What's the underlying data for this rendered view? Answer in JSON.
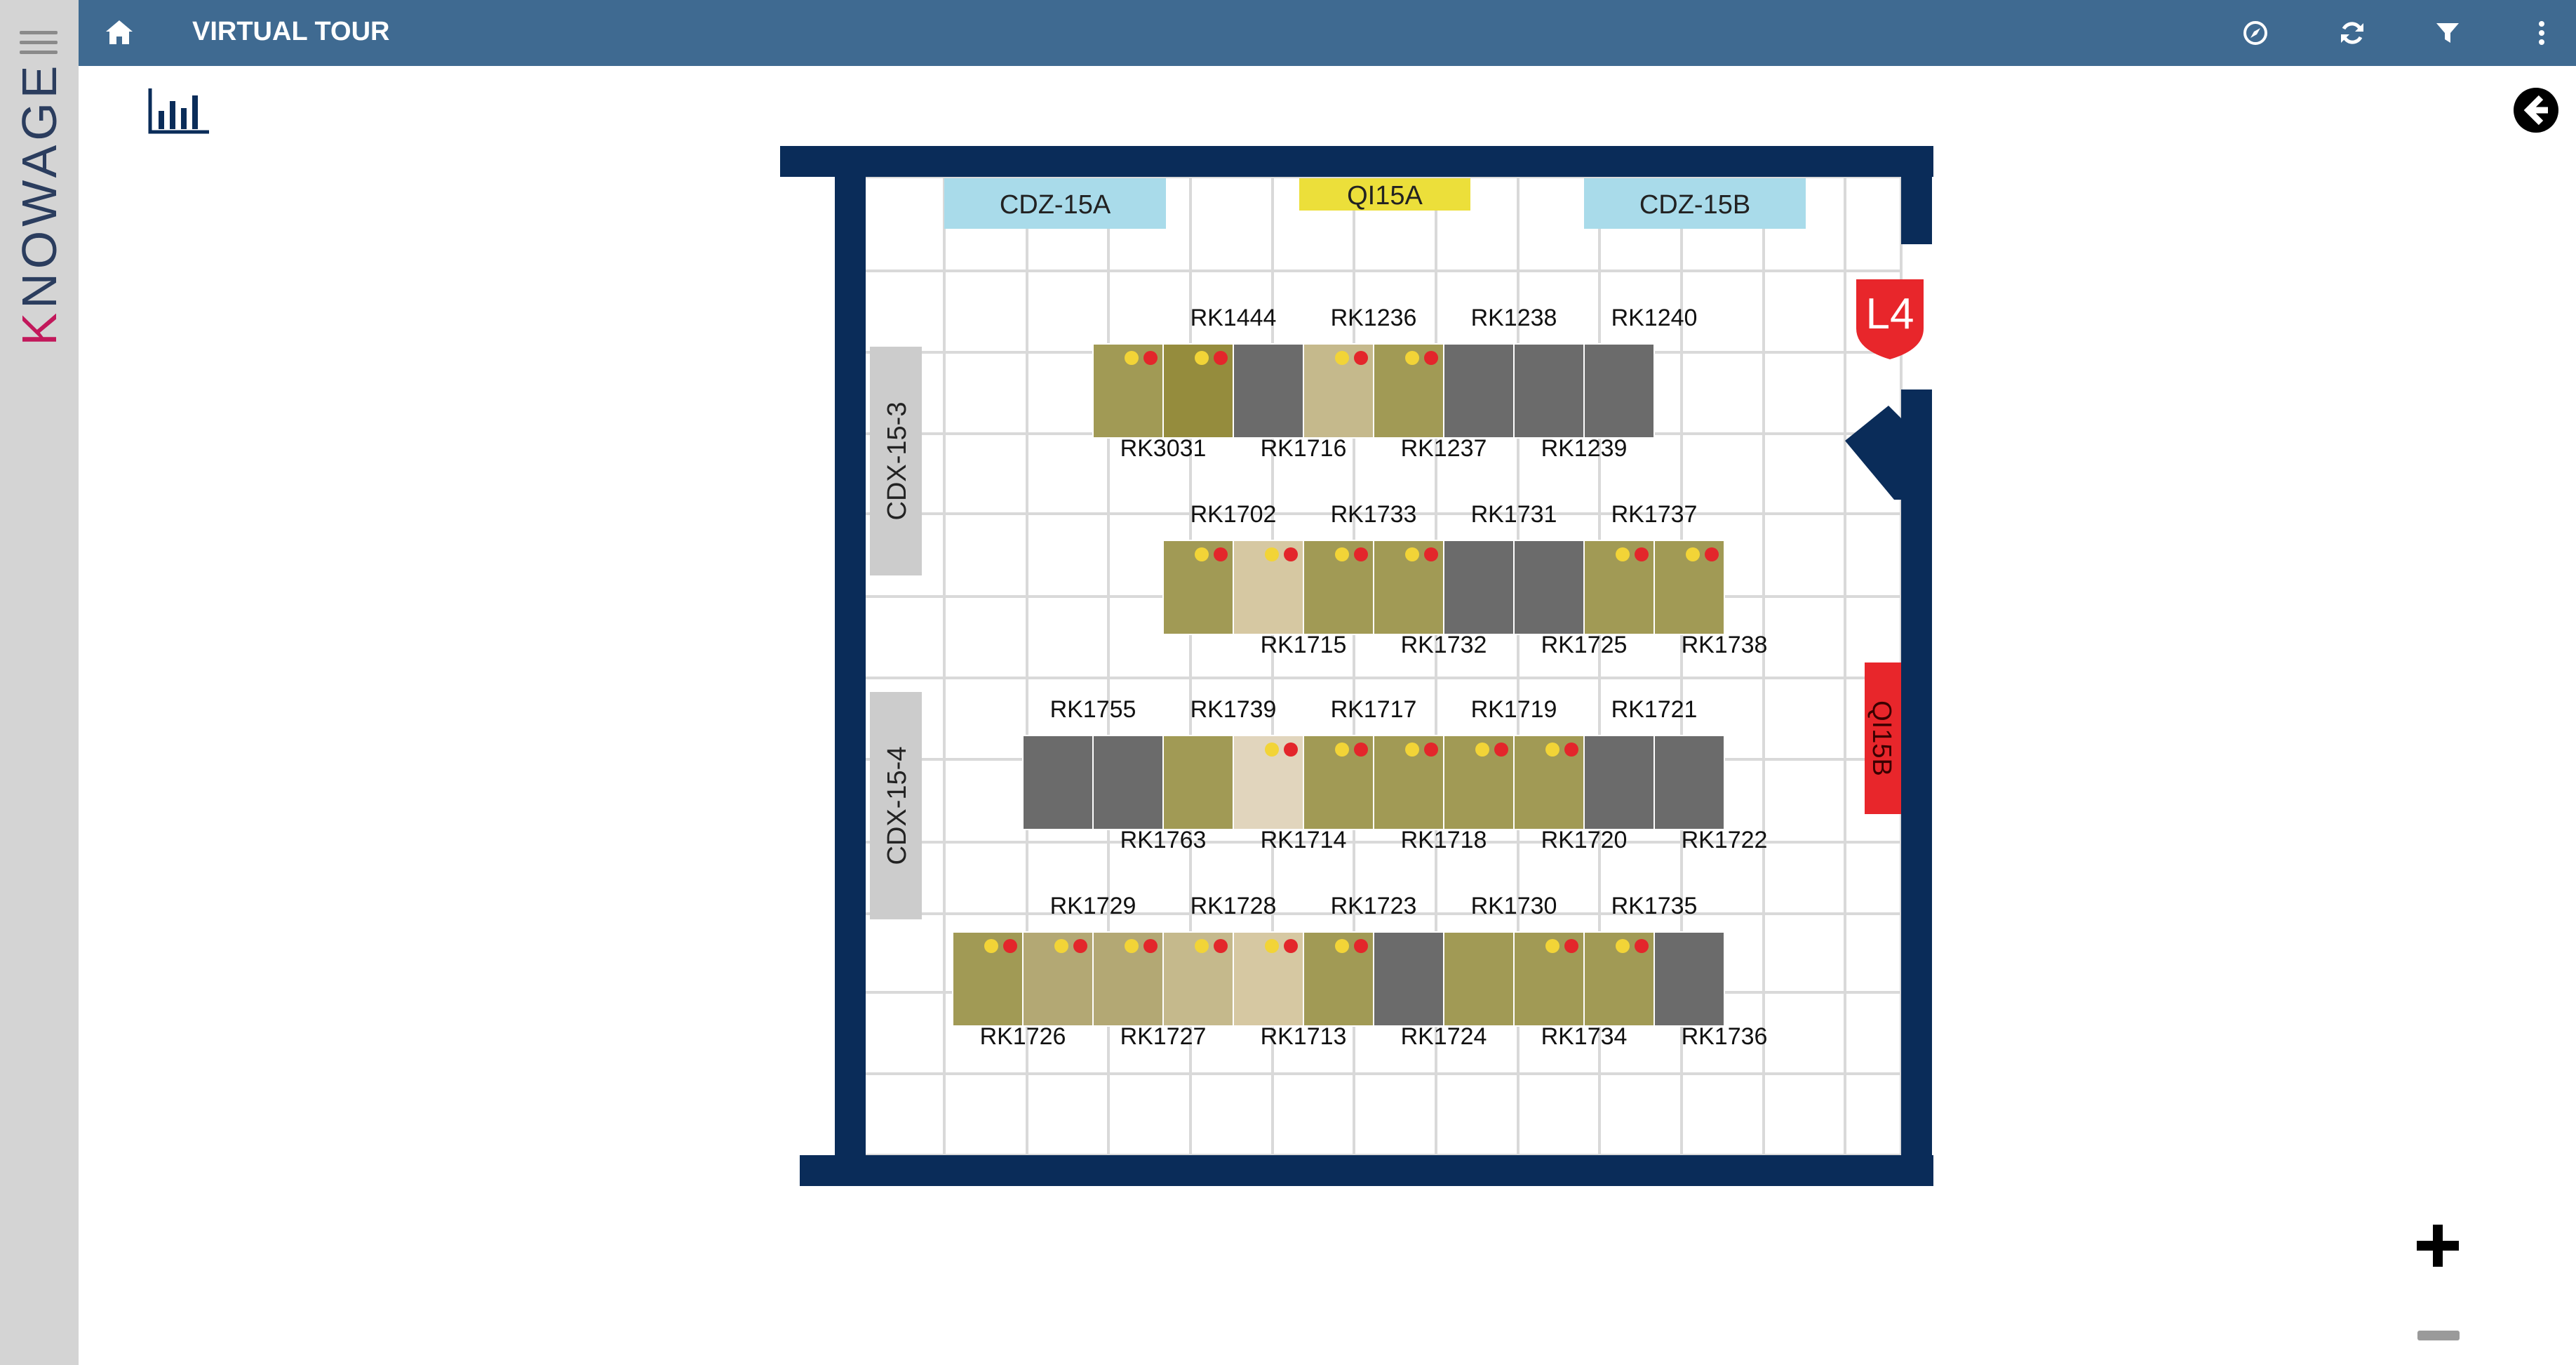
{
  "app": {
    "brand": "KNOWAGE",
    "brand_first": "K",
    "brand_rest": "NOWAGE"
  },
  "header": {
    "title": "VIRTUAL TOUR",
    "icons": [
      "home-icon",
      "compass-icon",
      "refresh-icon",
      "filter-icon",
      "more-vertical-icon"
    ]
  },
  "toolbar": {
    "chart_icon": "bar-chart-icon",
    "back_icon": "back-arrow-icon"
  },
  "colors": {
    "topbar": "#3f6a91",
    "wall": "#0a2c59",
    "grid": "#d9d9d9",
    "zone_blue": "#a9dbea",
    "zone_yellow": "#ecdf3a",
    "zone_gray": "#cccccc",
    "alert_red": "#e8262b",
    "dot_yellow": "#f2d437",
    "dot_red": "#e3262b",
    "rack_colors": {
      "o": "#a19a55",
      "d": "#958c3d",
      "g": "#6b6b6b",
      "l": "#c5b98c",
      "m": "#b3a874",
      "s": "#d6c8a2",
      "c": "#e1d5bd"
    }
  },
  "zones": [
    {
      "id": "z1",
      "label": "CDZ-15A",
      "color": "zone_blue",
      "orientation": "horizontal"
    },
    {
      "id": "z2",
      "label": "QI15A",
      "color": "zone_yellow",
      "orientation": "horizontal"
    },
    {
      "id": "z3",
      "label": "CDZ-15B",
      "color": "zone_blue",
      "orientation": "horizontal"
    },
    {
      "id": "z4",
      "label": "CDX-15-3",
      "color": "zone_gray",
      "orientation": "vertical"
    },
    {
      "id": "z5",
      "label": "CDX-15-4",
      "color": "zone_gray",
      "orientation": "vertical"
    },
    {
      "id": "z6",
      "label": "QI15B",
      "color": "alert_red",
      "orientation": "vertical-down"
    }
  ],
  "level_badge": "L4",
  "rack_rows": [
    {
      "top_labels": [
        "RK1444",
        "RK1236",
        "RK1238",
        "RK1240"
      ],
      "bottom_labels": [
        "RK3031",
        "RK1716",
        "RK1237",
        "RK1239"
      ],
      "racks": [
        {
          "c": "o",
          "dots": true
        },
        {
          "c": "d",
          "dots": true
        },
        {
          "c": "g",
          "dots": false
        },
        {
          "c": "l",
          "dots": true
        },
        {
          "c": "o",
          "dots": true
        },
        {
          "c": "g",
          "dots": false
        },
        {
          "c": "g",
          "dots": false
        },
        {
          "c": "g",
          "dots": false
        }
      ]
    },
    {
      "top_labels": [
        "RK1702",
        "RK1733",
        "RK1731",
        "RK1737"
      ],
      "bottom_labels": [
        "RK1715",
        "RK1732",
        "RK1725",
        "RK1738"
      ],
      "racks": [
        {
          "c": "o",
          "dots": true
        },
        {
          "c": "s",
          "dots": true
        },
        {
          "c": "o",
          "dots": true
        },
        {
          "c": "o",
          "dots": true
        },
        {
          "c": "g",
          "dots": false
        },
        {
          "c": "g",
          "dots": false
        },
        {
          "c": "o",
          "dots": true
        },
        {
          "c": "o",
          "dots": true
        }
      ]
    },
    {
      "top_labels": [
        "RK1755",
        "RK1739",
        "RK1717",
        "RK1719",
        "RK1721"
      ],
      "bottom_labels": [
        "RK1763",
        "RK1714",
        "RK1718",
        "RK1720",
        "RK1722"
      ],
      "racks": [
        {
          "c": "g",
          "dots": false
        },
        {
          "c": "g",
          "dots": false
        },
        {
          "c": "o",
          "dots": false
        },
        {
          "c": "c",
          "dots": true
        },
        {
          "c": "o",
          "dots": true
        },
        {
          "c": "o",
          "dots": true
        },
        {
          "c": "o",
          "dots": true
        },
        {
          "c": "o",
          "dots": true
        },
        {
          "c": "g",
          "dots": false
        },
        {
          "c": "g",
          "dots": false
        }
      ]
    },
    {
      "top_labels": [
        "RK1729",
        "RK1728",
        "RK1723",
        "RK1730",
        "RK1735"
      ],
      "bottom_labels": [
        "RK1726",
        "RK1727",
        "RK1713",
        "RK1724",
        "RK1734",
        "RK1736"
      ],
      "racks": [
        {
          "c": "o",
          "dots": true
        },
        {
          "c": "m",
          "dots": true
        },
        {
          "c": "m",
          "dots": true
        },
        {
          "c": "l",
          "dots": true
        },
        {
          "c": "s",
          "dots": true
        },
        {
          "c": "o",
          "dots": true
        },
        {
          "c": "g",
          "dots": false
        },
        {
          "c": "o",
          "dots": false
        },
        {
          "c": "o",
          "dots": true
        },
        {
          "c": "o",
          "dots": true
        },
        {
          "c": "g",
          "dots": false
        }
      ]
    }
  ],
  "zoom": {
    "in_icon": "plus-icon",
    "out_icon": "minus-icon"
  }
}
